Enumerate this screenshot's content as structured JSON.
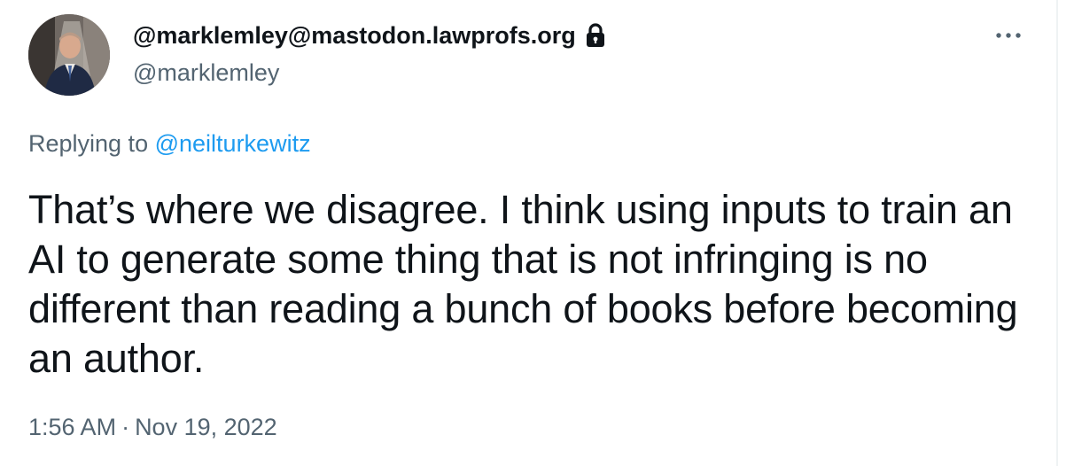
{
  "author": {
    "display_name": "@marklemley@mastodon.lawprofs.org",
    "handle": "@marklemley",
    "protected_icon": "lock-icon",
    "avatar_icon": "profile-photo"
  },
  "menu": {
    "more_icon": "more-horizontal-icon"
  },
  "reply_context": {
    "prefix": "Replying to",
    "mention": "@neilturkewitz"
  },
  "tweet": {
    "text": "That’s where we disagree. I think using inputs to train an AI to generate some thing that is not infringing is no different than reading a bunch of books before becoming an author.",
    "time": "1:56 AM",
    "separator": "·",
    "date": "Nov 19, 2022"
  },
  "colors": {
    "text_primary": "#0f1419",
    "text_secondary": "#536471",
    "link": "#1d9bf0",
    "divider": "#eff3f4"
  }
}
